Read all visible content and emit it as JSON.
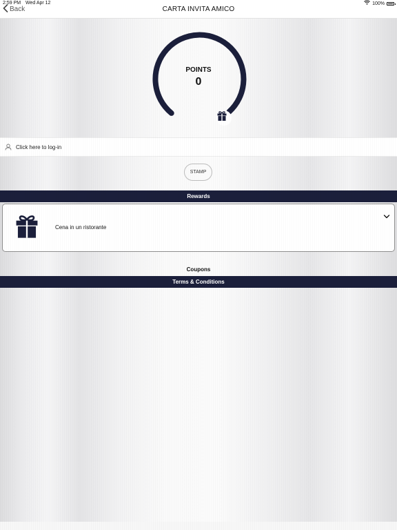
{
  "status_bar": {
    "time": "2:59 PM",
    "date": "Wed Apr 12",
    "battery": "100%",
    "icons": [
      "wifi-icon",
      "battery-icon"
    ]
  },
  "nav": {
    "back_label": "Back",
    "title": "CARTA INVITA AMICO"
  },
  "points": {
    "label": "POINTS",
    "value": "0",
    "icon": "gift-icon"
  },
  "login": {
    "text": "Click here to log-in",
    "icon": "user-icon"
  },
  "stamp": {
    "label": "STAMP"
  },
  "rewards": {
    "header": "Rewards",
    "items": [
      {
        "title": "Cena in un ristorante",
        "icon": "gift-icon"
      }
    ]
  },
  "coupons": {
    "label": "Coupons"
  },
  "terms": {
    "label": "Terms & Conditions"
  },
  "colors": {
    "navy": "#1b1f3b",
    "white": "#ffffff"
  }
}
